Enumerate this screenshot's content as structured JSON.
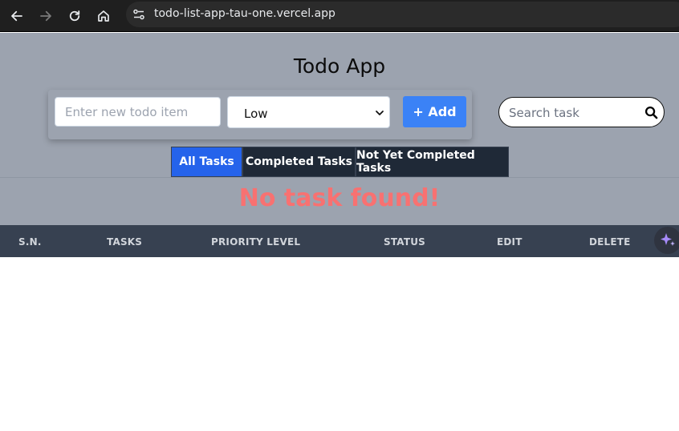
{
  "browser": {
    "url": "todo-list-app-tau-one.vercel.app",
    "icons": [
      "back-arrow-icon",
      "forward-arrow-icon",
      "reload-icon",
      "home-icon",
      "site-info-icon"
    ]
  },
  "app": {
    "title": "Todo App",
    "form": {
      "todo_placeholder": "Enter new todo item",
      "priority_selected": "Low",
      "add_label": "+ Add"
    },
    "search": {
      "placeholder": "Search task"
    },
    "tabs": [
      {
        "label": "All Tasks",
        "active": true
      },
      {
        "label": "Completed Tasks",
        "active": false
      },
      {
        "label": "Not Yet Completed Tasks",
        "active": false
      }
    ],
    "empty_message": "No task found!",
    "table": {
      "headers": [
        "S.N.",
        "TASKS",
        "PRIORITY LEVEL",
        "STATUS",
        "EDIT",
        "DELETE"
      ]
    }
  },
  "colors": {
    "app_background": "#9ca3af",
    "accent": "#3b82f6",
    "active_tab": "#2563eb",
    "tab_dark": "#1f2937",
    "empty_message": "#f87171",
    "table_header": "#374151"
  }
}
